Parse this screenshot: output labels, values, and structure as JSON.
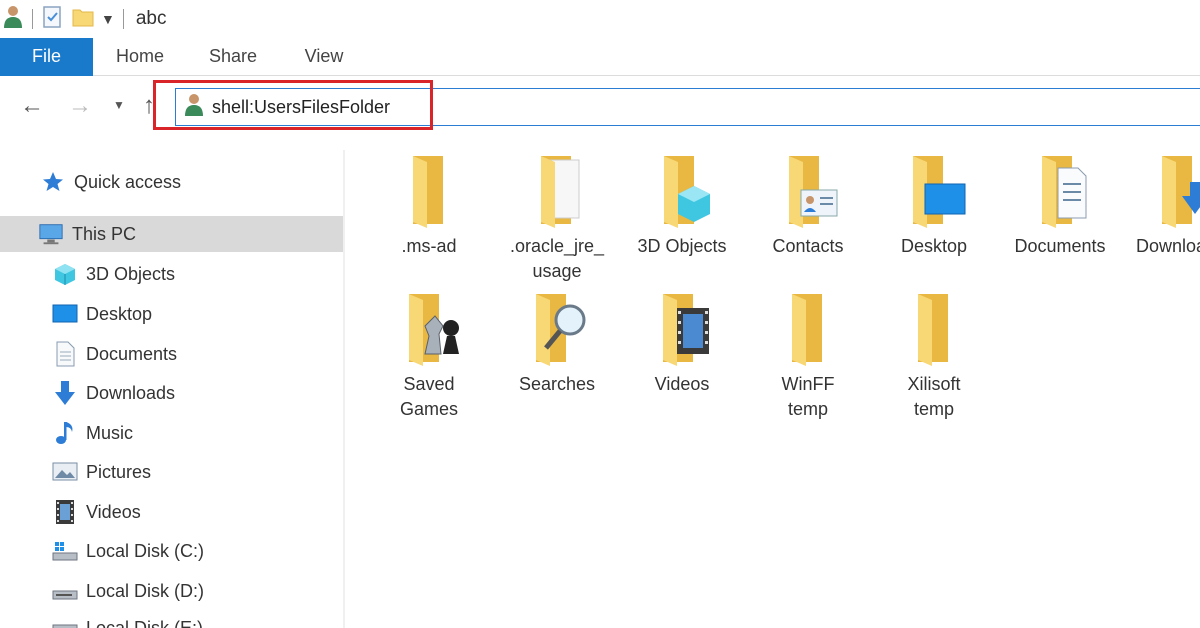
{
  "window": {
    "title": "abc"
  },
  "ribbon": {
    "tabs": [
      "File",
      "Home",
      "Share",
      "View"
    ]
  },
  "address": {
    "value": "shell:UsersFilesFolder"
  },
  "sidebar": {
    "quick_access": "Quick access",
    "this_pc": "This PC",
    "items": [
      "3D Objects",
      "Desktop",
      "Documents",
      "Downloads",
      "Music",
      "Pictures",
      "Videos",
      "Local Disk (C:)",
      "Local Disk (D:)",
      "Local Disk (E:)"
    ]
  },
  "content": {
    "row1": [
      ".ms-ad",
      ".oracle_jre_\nusage",
      "3D Objects",
      "Contacts",
      "Desktop",
      "Documents",
      "Downloads"
    ],
    "row2": [
      "Saved\nGames",
      "Searches",
      "Videos",
      "WinFF\ntemp",
      "Xilisoft\ntemp"
    ]
  },
  "colors": {
    "accent": "#1979ca",
    "highlight": "#d9252a",
    "folder": "#f8d775",
    "selected_bg": "#d9d9d9"
  }
}
